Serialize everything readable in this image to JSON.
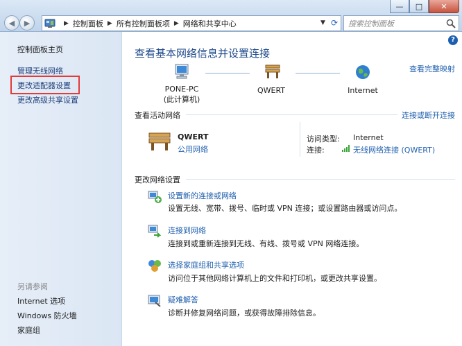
{
  "breadcrumb": [
    "控制面板",
    "所有控制面板项",
    "网络和共享中心"
  ],
  "search": {
    "placeholder": "搜索控制面板"
  },
  "window_buttons": {
    "min": "—",
    "max": "□",
    "close": "✕"
  },
  "left_pane": {
    "home": "控制面板主页",
    "links": [
      "管理无线网络",
      "更改适配器设置",
      "更改高级共享设置"
    ],
    "see_also_title": "另请参阅",
    "see_also": [
      "Internet 选项",
      "Windows 防火墙",
      "家庭组"
    ]
  },
  "main": {
    "title": "查看基本网络信息并设置连接",
    "full_map": "查看完整映射",
    "nodes": [
      {
        "line1": "PONE-PC",
        "line2": "(此计算机)"
      },
      {
        "line1": "QWERT",
        "line2": ""
      },
      {
        "line1": "Internet",
        "line2": ""
      }
    ],
    "active_networks": {
      "title": "查看活动网络",
      "connect_link": "连接或断开连接",
      "network_name": "QWERT",
      "network_type": "公用网络",
      "access_type_label": "访问类型:",
      "access_type_value": "Internet",
      "connection_label": "连接:",
      "connection_value": "无线网络连接 (QWERT)"
    },
    "change_settings": {
      "title": "更改网络设置",
      "tasks": [
        {
          "title": "设置新的连接或网络",
          "desc": "设置无线、宽带、拨号、临时或 VPN 连接；或设置路由器或访问点。"
        },
        {
          "title": "连接到网络",
          "desc": "连接到或重新连接到无线、有线、拨号或 VPN 网络连接。"
        },
        {
          "title": "选择家庭组和共享选项",
          "desc": "访问位于其他网络计算机上的文件和打印机，或更改共享设置。"
        },
        {
          "title": "疑难解答",
          "desc": "诊断并修复网络问题，或获得故障排除信息。"
        }
      ]
    }
  }
}
